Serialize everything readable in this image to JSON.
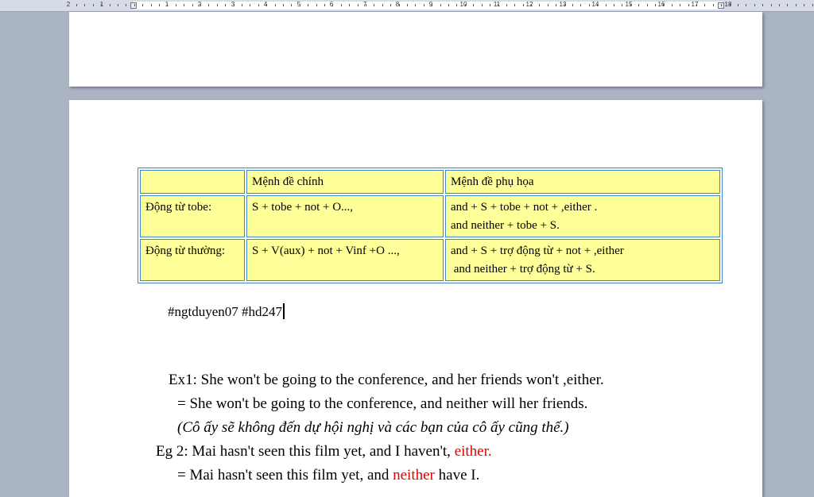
{
  "ruler": {
    "labels": [
      "2",
      "1",
      "1",
      "2",
      "3",
      "4",
      "5",
      "6",
      "7",
      "8",
      "9",
      "10",
      "11",
      "12",
      "13",
      "14",
      "15",
      "16",
      "17",
      "18"
    ]
  },
  "table": {
    "header": [
      "",
      "Mệnh đề chính",
      "Mệnh đề phụ họa"
    ],
    "rows": [
      {
        "label": "Động từ tobe:",
        "main": "S + tobe + not + O...,",
        "sub": [
          "and + S + tobe + not + ,either .",
          "and neither + tobe + S."
        ]
      },
      {
        "label": "Động từ thường:",
        "main": "S + V(aux) + not + Vinf +O ...,",
        "sub": [
          "and + S + trợ động từ + not + ,either",
          " and neither + trợ động từ + S."
        ]
      }
    ],
    "colors": {
      "cell": "#ffff99",
      "border": "#3f86c9"
    }
  },
  "body": {
    "hashtags": "#ngtduyen07 #hd247",
    "ex1": "Ex1: She won't be going to the conference, and her friends won't ,either.",
    "ex1_rewrite": "= She won't be going to the conference, and neither will her friends.",
    "ex1_translation": "(Cô ấy sẽ không đến dự hội nghị và các bạn của cô ấy cũng thế.)",
    "eg2_prefix": "Eg 2: Mai hasn't seen this film yet, and I haven't, ",
    "eg2_highlight": "either.",
    "eg2_rewrite_prefix": "= Mai hasn't seen this film yet, and ",
    "eg2_rewrite_highlight": "neither",
    "eg2_rewrite_suffix": " have I.",
    "highlight_color": "#e00000"
  }
}
